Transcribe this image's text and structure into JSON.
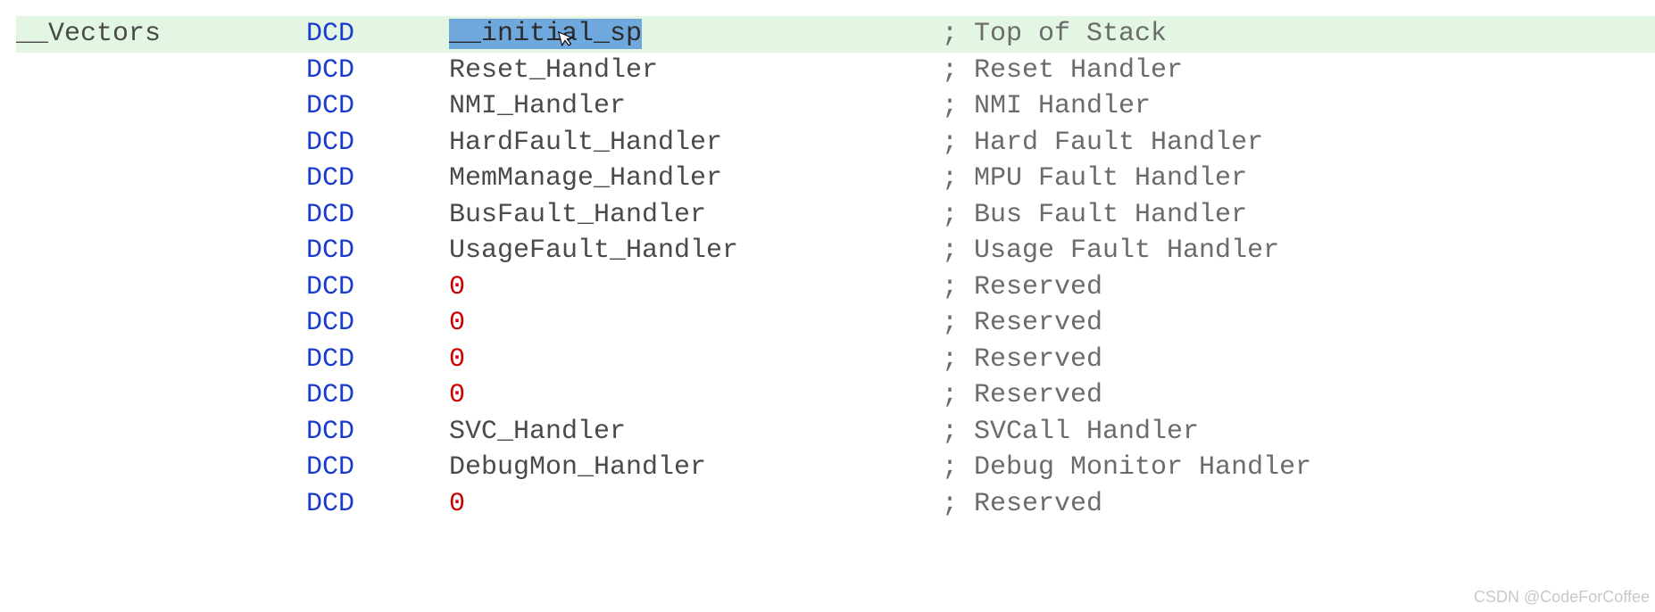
{
  "watermark": "CSDN @CodeForCoffee",
  "lines": [
    {
      "label": "__Vectors",
      "directive": "DCD",
      "operand": "__initial_sp",
      "operand_type": "selected",
      "comment": "Top of Stack",
      "highlighted": true
    },
    {
      "label": "",
      "directive": "DCD",
      "operand": "Reset_Handler",
      "operand_type": "id",
      "comment": "Reset Handler",
      "highlighted": false
    },
    {
      "label": "",
      "directive": "DCD",
      "operand": "NMI_Handler",
      "operand_type": "id",
      "comment": "NMI Handler",
      "highlighted": false
    },
    {
      "label": "",
      "directive": "DCD",
      "operand": "HardFault_Handler",
      "operand_type": "id",
      "comment": "Hard Fault Handler",
      "highlighted": false
    },
    {
      "label": "",
      "directive": "DCD",
      "operand": "MemManage_Handler",
      "operand_type": "id",
      "comment": "MPU Fault Handler",
      "highlighted": false
    },
    {
      "label": "",
      "directive": "DCD",
      "operand": "BusFault_Handler",
      "operand_type": "id",
      "comment": "Bus Fault Handler",
      "highlighted": false
    },
    {
      "label": "",
      "directive": "DCD",
      "operand": "UsageFault_Handler",
      "operand_type": "id",
      "comment": "Usage Fault Handler",
      "highlighted": false
    },
    {
      "label": "",
      "directive": "DCD",
      "operand": "0",
      "operand_type": "num",
      "comment": "Reserved",
      "highlighted": false
    },
    {
      "label": "",
      "directive": "DCD",
      "operand": "0",
      "operand_type": "num",
      "comment": "Reserved",
      "highlighted": false
    },
    {
      "label": "",
      "directive": "DCD",
      "operand": "0",
      "operand_type": "num",
      "comment": "Reserved",
      "highlighted": false
    },
    {
      "label": "",
      "directive": "DCD",
      "operand": "0",
      "operand_type": "num",
      "comment": "Reserved",
      "highlighted": false
    },
    {
      "label": "",
      "directive": "DCD",
      "operand": "SVC_Handler",
      "operand_type": "id",
      "comment": "SVCall Handler",
      "highlighted": false
    },
    {
      "label": "",
      "directive": "DCD",
      "operand": "DebugMon_Handler",
      "operand_type": "id",
      "comment": "Debug Monitor Handler",
      "highlighted": false
    },
    {
      "label": "",
      "directive": "DCD",
      "operand": "0",
      "operand_type": "num",
      "comment": "Reserved",
      "highlighted": false
    }
  ]
}
